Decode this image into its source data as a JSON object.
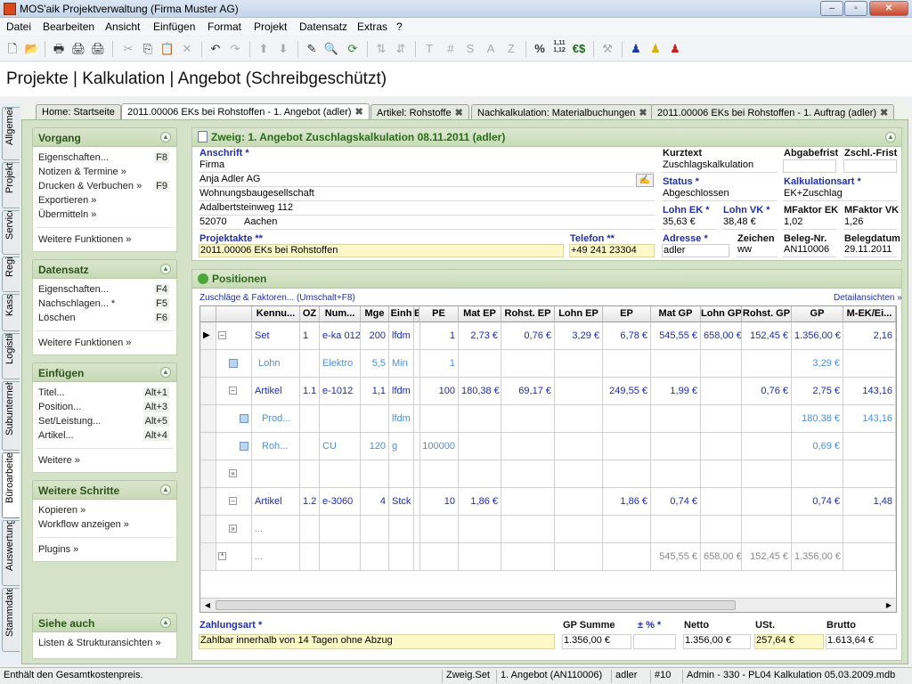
{
  "window": {
    "title": "MOS'aik Projektverwaltung (Firma Muster AG)",
    "min": "–",
    "max": "▫",
    "close": "✕"
  },
  "menu": [
    "Datei",
    "Bearbeiten",
    "Ansicht",
    "Einfügen",
    "Format",
    "Projekt",
    "Datensatz",
    "Extras",
    "?"
  ],
  "toolbar_text": {
    "t": "T",
    "hash": "#",
    "s": "S",
    "a": "A",
    "z": "Z",
    "pct": "%",
    "num": "1,11\n1,12",
    "eur": "€$"
  },
  "page_title": "Projekte | Kalkulation | Angebot (Schreibgeschützt)",
  "side_tabs": [
    "Allgemein",
    "Projekte",
    "Service",
    "Regie",
    "Kasse",
    "Logistik",
    "Subunternehmer",
    "Büroarbeiten",
    "Auswertungen",
    "Stammdaten"
  ],
  "doc_tabs": [
    {
      "label": "Home: Startseite",
      "close": ""
    },
    {
      "label": "2011.00006 EKs bei Rohstoffen - 1. Angebot (adler)",
      "close": "✖"
    },
    {
      "label": "Artikel: Rohstoffe",
      "close": "✖"
    },
    {
      "label": "Nachkalkulation: Materialbuchungen",
      "close": "✖"
    },
    {
      "label": "2011.00006 EKs bei Rohstoffen - 1. Auftrag (adler)",
      "close": "✖"
    }
  ],
  "vorgang": {
    "title": "Vorgang",
    "items": [
      {
        "label": "Eigenschaften...",
        "key": "F8"
      },
      {
        "label": "Notizen & Termine »",
        "key": ""
      },
      {
        "label": "Drucken & Verbuchen »",
        "key": "F9"
      },
      {
        "label": "Exportieren »",
        "key": ""
      },
      {
        "label": "Übermitteln »",
        "key": ""
      }
    ],
    "more": "Weitere Funktionen »"
  },
  "datensatz": {
    "title": "Datensatz",
    "items": [
      {
        "label": "Eigenschaften...",
        "key": "F4"
      },
      {
        "label": "Nachschlagen... *",
        "key": "F5"
      },
      {
        "label": "Löschen",
        "key": "F6"
      }
    ],
    "more": "Weitere Funktionen »"
  },
  "einfuegen": {
    "title": "Einfügen",
    "items": [
      {
        "label": "Titel...",
        "key": "Alt+1"
      },
      {
        "label": "Position...",
        "key": "Alt+3"
      },
      {
        "label": "Set/Leistung...",
        "key": "Alt+5"
      },
      {
        "label": "Artikel...",
        "key": "Alt+4"
      }
    ],
    "more": "Weitere »"
  },
  "schritte": {
    "title": "Weitere Schritte",
    "items": [
      "Kopieren »",
      "Workflow anzeigen »"
    ],
    "more": "Plugins »"
  },
  "siehe": {
    "title": "Siehe auch",
    "items": [
      "Listen & Strukturansichten »"
    ]
  },
  "zweig": {
    "title": "Zweig: 1. Angebot Zuschlagskalkulation 08.11.2011 (adler)",
    "anschrift_label": "Anschrift *",
    "anschrift": [
      "Firma",
      "Anja Adler AG",
      "Wohnungsbaugesellschaft",
      "Adalbertsteinweg 112"
    ],
    "plz": "52070",
    "ort": "Aachen",
    "projektakte_label": "Projektakte **",
    "projektakte": "2011.00006 EKs bei Rohstoffen",
    "telefon_label": "Telefon **",
    "telefon": "+49 241 23304",
    "kurztext_label": "Kurztext",
    "kurztext": "Zuschlagskalkulation",
    "abgabefrist_label": "Abgabefrist",
    "abgabefrist": "",
    "zschl_label": "Zschl.-Frist",
    "zschl": "",
    "status_label": "Status *",
    "status": "Abgeschlossen",
    "kalkart_label": "Kalkulationsart *",
    "kalkart": "EK+Zuschlag",
    "lohnek_label": "Lohn EK *",
    "lohnek": "35,63 €",
    "lohnvk_label": "Lohn VK *",
    "lohnvk": "38,48 €",
    "mfek_label": "MFaktor EK",
    "mfek": "1,02",
    "mfvk_label": "MFaktor VK",
    "mfvk": "1,26",
    "adresse_label": "Adresse *",
    "adresse": "adler",
    "zeichen_label": "Zeichen",
    "zeichen": "ww",
    "belegnr_label": "Beleg-Nr.",
    "belegnr": "AN110006",
    "belegdatum_label": "Belegdatum",
    "belegdatum": "29.11.2011"
  },
  "positionen": {
    "title": "Positionen",
    "zuschlaege": "Zuschläge & Faktoren... (Umschalt+F8)",
    "detail": "Detailansichten »",
    "columns": [
      "Kennu...",
      "OZ",
      "Num...",
      "Mge",
      "Einh",
      "E",
      "PE",
      "Mat EP",
      "Rohst. EP",
      "Lohn EP",
      "EP",
      "Mat GP",
      "Lohn GP",
      "Rohst. GP",
      "GP",
      "M-EK/Ei..."
    ],
    "rows": [
      [
        "Set",
        "1",
        "e-ka 012",
        "200",
        "lfdm",
        "",
        "1",
        "2,73 €",
        "0,76 €",
        "3,29 €",
        "6,78 €",
        "545,55 €",
        "658,00 €",
        "152,45 €",
        "1.356,00 €",
        "2,16"
      ],
      [
        "Lohn",
        "",
        "Elektro",
        "5,5",
        "Min",
        "",
        "1",
        "",
        "",
        "",
        "",
        "",
        "",
        "",
        "3,29 €",
        ""
      ],
      [
        "Artikel",
        "1.1",
        "e-1012",
        "1,1",
        "lfdm",
        "",
        "100",
        "180,38 €",
        "69,17 €",
        "",
        "249,55 €",
        "1,99 €",
        "",
        "0,76 €",
        "2,75 €",
        "143,16"
      ],
      [
        "Prod...",
        "",
        "",
        "",
        "lfdm",
        "",
        "",
        "",
        "",
        "",
        "",
        "",
        "",
        "",
        "180,38 €",
        "143,16"
      ],
      [
        "Roh...",
        "",
        "CU",
        "120",
        "g",
        "",
        "100000",
        "",
        "",
        "",
        "",
        "",
        "",
        "",
        "0,69 €",
        ""
      ],
      [
        "",
        "",
        "",
        "",
        "",
        "",
        "",
        "",
        "",
        "",
        "",
        "",
        "",
        "",
        "",
        ""
      ],
      [
        "Artikel",
        "1.2",
        "e-3060",
        "4",
        "Stck",
        "",
        "10",
        "1,86 €",
        "",
        "",
        "1,86 €",
        "0,74 €",
        "",
        "",
        "0,74 €",
        "1,48"
      ],
      [
        "...",
        "",
        "",
        "",
        "",
        "",
        "",
        "",
        "",
        "",
        "",
        "",
        "",
        "",
        "",
        ""
      ],
      [
        "...",
        "",
        "",
        "",
        "",
        "",
        "",
        "",
        "",
        "",
        "",
        "545,55 €",
        "658,00 €",
        "152,45 €",
        "1.356,00 €",
        ""
      ]
    ]
  },
  "footer": {
    "zahlungsart_label": "Zahlungsart *",
    "zahlungsart": "Zahlbar innerhalb von 14 Tagen ohne Abzug",
    "gpsumme_label": "GP Summe",
    "gpsumme": "1.356,00 €",
    "pct_label": "± % *",
    "pct": "",
    "netto_label": "Netto",
    "netto": "1.356,00 €",
    "ust_label": "USt.",
    "ust": "257,64 €",
    "brutto_label": "Brutto",
    "brutto": "1.613,64 €"
  },
  "status": {
    "left": "Enthält den Gesamtkostenpreis.",
    "zweig": "Zweig.Set",
    "beleg": "1. Angebot (AN110006)",
    "user": "adler",
    "num": "#10",
    "info": "Admin - 330 - PL04 Kalkulation 05.03.2009.mdb"
  },
  "colors": {
    "accent_green": "#2a6b1a",
    "label_blue": "#2030a8",
    "value_blue": "#1a2ab8",
    "highlight_yellow": "#fdf8c8"
  }
}
